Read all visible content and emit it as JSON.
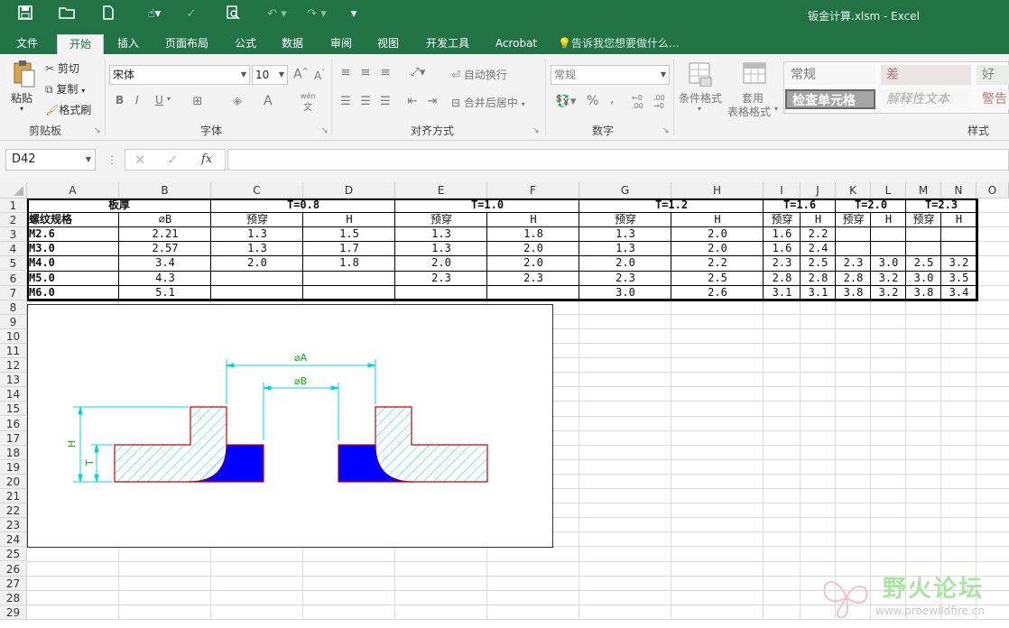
{
  "window": {
    "title": "钣金计算.xlsm - Excel"
  },
  "tabs": [
    "文件",
    "开始",
    "插入",
    "页面布局",
    "公式",
    "数据",
    "审阅",
    "视图",
    "开发工具",
    "Acrobat"
  ],
  "tell_me": "告诉我您想要做什么...",
  "ribbon": {
    "clipboard": {
      "paste": "粘贴",
      "cut": "剪切",
      "copy": "复制",
      "format_painter": "格式刷",
      "label": "剪贴板"
    },
    "font": {
      "name": "宋体",
      "size": "10",
      "label": "字体",
      "bold": "B",
      "italic": "I",
      "underline": "U",
      "grow": "A",
      "shrink": "A",
      "font_color": "A",
      "phonetic": "wén"
    },
    "alignment": {
      "wrap": "自动换行",
      "merge": "合并后居中",
      "label": "对齐方式"
    },
    "number": {
      "format": "常规",
      "label": "数字",
      "percent": "%",
      "comma": ",",
      "inc_decimal": "←0 .00",
      "dec_decimal": ".00 →0"
    },
    "styles": {
      "cond_format": "条件格式",
      "table_format_1": "套用",
      "table_format_2": "表格格式",
      "normal": "常规",
      "bad": "差",
      "good": "好",
      "check_cell": "检查单元格",
      "explanatory": "解释性文本",
      "warning": "警告",
      "label": "样式"
    }
  },
  "formula_bar": {
    "name_box": "D42",
    "formula": "",
    "fx": "fx"
  },
  "sheet": {
    "columns": [
      "A",
      "B",
      "C",
      "D",
      "E",
      "F",
      "G",
      "H",
      "I",
      "J",
      "K",
      "L",
      "M",
      "N",
      "O"
    ],
    "rows": [
      "1",
      "2",
      "3",
      "4",
      "5",
      "6",
      "7",
      "8",
      "9",
      "10",
      "11",
      "12",
      "13",
      "14",
      "15",
      "16",
      "17",
      "18",
      "19",
      "20",
      "21",
      "22",
      "23",
      "24",
      "25",
      "26",
      "27",
      "28",
      "29"
    ],
    "row1": {
      "a": "板厚",
      "t08": "T=0.8",
      "t10": "T=1.0",
      "t12": "T=1.2",
      "t16": "T=1.6",
      "t20": "T=2.0",
      "t23": "T=2.3"
    },
    "row2": [
      "螺纹规格",
      "⌀B",
      "预穿",
      "H",
      "预穿",
      "H",
      "预穿",
      "H",
      "预穿",
      "H",
      "预穿",
      "H",
      "预穿",
      "H"
    ],
    "data": [
      [
        "M2.6",
        "2.21",
        "1.3",
        "1.5",
        "1.3",
        "1.8",
        "1.3",
        "2.0",
        "1.6",
        "2.2",
        "",
        "",
        "",
        ""
      ],
      [
        "M3.0",
        "2.57",
        "1.3",
        "1.7",
        "1.3",
        "2.0",
        "1.3",
        "2.0",
        "1.6",
        "2.4",
        "",
        "",
        "",
        ""
      ],
      [
        "M4.0",
        "3.4",
        "2.0",
        "1.8",
        "2.0",
        "2.0",
        "2.0",
        "2.2",
        "2.3",
        "2.5",
        "2.3",
        "3.0",
        "2.5",
        "3.2"
      ],
      [
        "M5.0",
        "4.3",
        "",
        "",
        "2.3",
        "2.3",
        "2.3",
        "2.5",
        "2.8",
        "2.8",
        "2.8",
        "3.2",
        "3.0",
        "3.5"
      ],
      [
        "M6.0",
        "5.1",
        "",
        "",
        "",
        "",
        "3.0",
        "2.6",
        "3.1",
        "3.1",
        "3.8",
        "3.2",
        "3.8",
        "3.4"
      ]
    ]
  },
  "drawing": {
    "dim_a": "⌀A",
    "dim_b": "⌀B",
    "dim_h": "H",
    "dim_t": "T"
  },
  "watermark": {
    "text": "野火论坛",
    "url": "www.proewildfire.cn"
  },
  "colors": {
    "excel_green": "#217346",
    "cad_cyan": "#00e0e0",
    "cad_blue": "#0000ff",
    "cad_red": "#cc0000",
    "dim_green": "#00c000"
  }
}
